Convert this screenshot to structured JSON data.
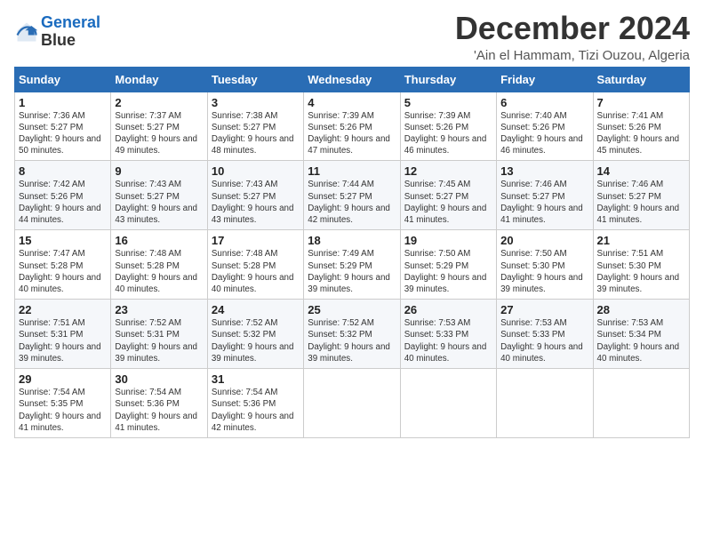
{
  "logo": {
    "line1": "General",
    "line2": "Blue"
  },
  "title": "December 2024",
  "location": "'Ain el Hammam, Tizi Ouzou, Algeria",
  "header": {
    "days": [
      "Sunday",
      "Monday",
      "Tuesday",
      "Wednesday",
      "Thursday",
      "Friday",
      "Saturday"
    ]
  },
  "weeks": [
    [
      {
        "day": "1",
        "sunrise": "Sunrise: 7:36 AM",
        "sunset": "Sunset: 5:27 PM",
        "daylight": "Daylight: 9 hours and 50 minutes."
      },
      {
        "day": "2",
        "sunrise": "Sunrise: 7:37 AM",
        "sunset": "Sunset: 5:27 PM",
        "daylight": "Daylight: 9 hours and 49 minutes."
      },
      {
        "day": "3",
        "sunrise": "Sunrise: 7:38 AM",
        "sunset": "Sunset: 5:27 PM",
        "daylight": "Daylight: 9 hours and 48 minutes."
      },
      {
        "day": "4",
        "sunrise": "Sunrise: 7:39 AM",
        "sunset": "Sunset: 5:26 PM",
        "daylight": "Daylight: 9 hours and 47 minutes."
      },
      {
        "day": "5",
        "sunrise": "Sunrise: 7:39 AM",
        "sunset": "Sunset: 5:26 PM",
        "daylight": "Daylight: 9 hours and 46 minutes."
      },
      {
        "day": "6",
        "sunrise": "Sunrise: 7:40 AM",
        "sunset": "Sunset: 5:26 PM",
        "daylight": "Daylight: 9 hours and 46 minutes."
      },
      {
        "day": "7",
        "sunrise": "Sunrise: 7:41 AM",
        "sunset": "Sunset: 5:26 PM",
        "daylight": "Daylight: 9 hours and 45 minutes."
      }
    ],
    [
      {
        "day": "8",
        "sunrise": "Sunrise: 7:42 AM",
        "sunset": "Sunset: 5:26 PM",
        "daylight": "Daylight: 9 hours and 44 minutes."
      },
      {
        "day": "9",
        "sunrise": "Sunrise: 7:43 AM",
        "sunset": "Sunset: 5:27 PM",
        "daylight": "Daylight: 9 hours and 43 minutes."
      },
      {
        "day": "10",
        "sunrise": "Sunrise: 7:43 AM",
        "sunset": "Sunset: 5:27 PM",
        "daylight": "Daylight: 9 hours and 43 minutes."
      },
      {
        "day": "11",
        "sunrise": "Sunrise: 7:44 AM",
        "sunset": "Sunset: 5:27 PM",
        "daylight": "Daylight: 9 hours and 42 minutes."
      },
      {
        "day": "12",
        "sunrise": "Sunrise: 7:45 AM",
        "sunset": "Sunset: 5:27 PM",
        "daylight": "Daylight: 9 hours and 41 minutes."
      },
      {
        "day": "13",
        "sunrise": "Sunrise: 7:46 AM",
        "sunset": "Sunset: 5:27 PM",
        "daylight": "Daylight: 9 hours and 41 minutes."
      },
      {
        "day": "14",
        "sunrise": "Sunrise: 7:46 AM",
        "sunset": "Sunset: 5:27 PM",
        "daylight": "Daylight: 9 hours and 41 minutes."
      }
    ],
    [
      {
        "day": "15",
        "sunrise": "Sunrise: 7:47 AM",
        "sunset": "Sunset: 5:28 PM",
        "daylight": "Daylight: 9 hours and 40 minutes."
      },
      {
        "day": "16",
        "sunrise": "Sunrise: 7:48 AM",
        "sunset": "Sunset: 5:28 PM",
        "daylight": "Daylight: 9 hours and 40 minutes."
      },
      {
        "day": "17",
        "sunrise": "Sunrise: 7:48 AM",
        "sunset": "Sunset: 5:28 PM",
        "daylight": "Daylight: 9 hours and 40 minutes."
      },
      {
        "day": "18",
        "sunrise": "Sunrise: 7:49 AM",
        "sunset": "Sunset: 5:29 PM",
        "daylight": "Daylight: 9 hours and 39 minutes."
      },
      {
        "day": "19",
        "sunrise": "Sunrise: 7:50 AM",
        "sunset": "Sunset: 5:29 PM",
        "daylight": "Daylight: 9 hours and 39 minutes."
      },
      {
        "day": "20",
        "sunrise": "Sunrise: 7:50 AM",
        "sunset": "Sunset: 5:30 PM",
        "daylight": "Daylight: 9 hours and 39 minutes."
      },
      {
        "day": "21",
        "sunrise": "Sunrise: 7:51 AM",
        "sunset": "Sunset: 5:30 PM",
        "daylight": "Daylight: 9 hours and 39 minutes."
      }
    ],
    [
      {
        "day": "22",
        "sunrise": "Sunrise: 7:51 AM",
        "sunset": "Sunset: 5:31 PM",
        "daylight": "Daylight: 9 hours and 39 minutes."
      },
      {
        "day": "23",
        "sunrise": "Sunrise: 7:52 AM",
        "sunset": "Sunset: 5:31 PM",
        "daylight": "Daylight: 9 hours and 39 minutes."
      },
      {
        "day": "24",
        "sunrise": "Sunrise: 7:52 AM",
        "sunset": "Sunset: 5:32 PM",
        "daylight": "Daylight: 9 hours and 39 minutes."
      },
      {
        "day": "25",
        "sunrise": "Sunrise: 7:52 AM",
        "sunset": "Sunset: 5:32 PM",
        "daylight": "Daylight: 9 hours and 39 minutes."
      },
      {
        "day": "26",
        "sunrise": "Sunrise: 7:53 AM",
        "sunset": "Sunset: 5:33 PM",
        "daylight": "Daylight: 9 hours and 40 minutes."
      },
      {
        "day": "27",
        "sunrise": "Sunrise: 7:53 AM",
        "sunset": "Sunset: 5:33 PM",
        "daylight": "Daylight: 9 hours and 40 minutes."
      },
      {
        "day": "28",
        "sunrise": "Sunrise: 7:53 AM",
        "sunset": "Sunset: 5:34 PM",
        "daylight": "Daylight: 9 hours and 40 minutes."
      }
    ],
    [
      {
        "day": "29",
        "sunrise": "Sunrise: 7:54 AM",
        "sunset": "Sunset: 5:35 PM",
        "daylight": "Daylight: 9 hours and 41 minutes."
      },
      {
        "day": "30",
        "sunrise": "Sunrise: 7:54 AM",
        "sunset": "Sunset: 5:36 PM",
        "daylight": "Daylight: 9 hours and 41 minutes."
      },
      {
        "day": "31",
        "sunrise": "Sunrise: 7:54 AM",
        "sunset": "Sunset: 5:36 PM",
        "daylight": "Daylight: 9 hours and 42 minutes."
      },
      null,
      null,
      null,
      null
    ]
  ]
}
